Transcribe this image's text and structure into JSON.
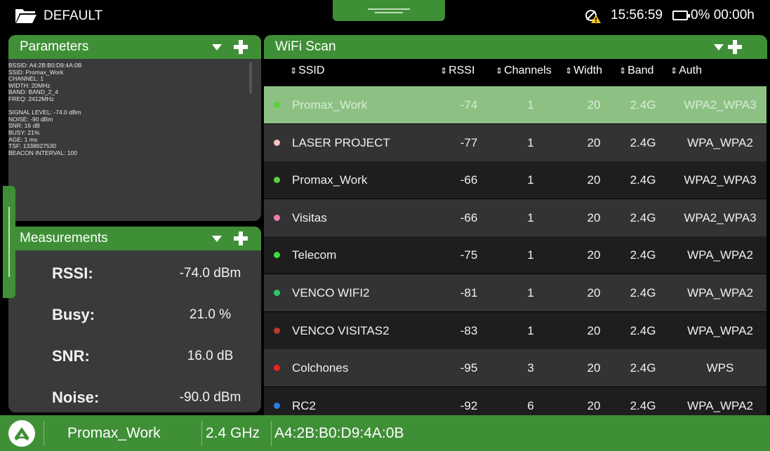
{
  "header": {
    "app_name": "DEFAULT",
    "time": "15:56:59",
    "battery": "0% 00:00h"
  },
  "parameters": {
    "title": "Parameters",
    "lines": [
      "BSSID: A4:2B:B0:D9:4A:0B",
      "SSID: Promax_Work",
      "CHANNEL: 1",
      "WIDTH: 20MHz",
      "BAND: BAND_2_4",
      "FREQ: 2412MHz",
      "",
      "SIGNAL LEVEL: -74.0 dBm",
      "NOISE: -90 dBm",
      "SNR: 16 dB",
      "BUSY: 21%",
      "AGE: 1 ms",
      "TSF: 1338927530",
      "BEACON INTERVAL: 100"
    ]
  },
  "measurements": {
    "title": "Measurements",
    "items": [
      {
        "label": "RSSI:",
        "value": "-74.0 dBm"
      },
      {
        "label": "Busy:",
        "value": "21.0 %"
      },
      {
        "label": "SNR:",
        "value": "16.0 dB"
      },
      {
        "label": "Noise:",
        "value": "-90.0 dBm"
      }
    ]
  },
  "wifi_scan": {
    "title": "WiFi Scan",
    "columns": [
      "SSID",
      "RSSI",
      "Channels",
      "Width",
      "Band",
      "Auth"
    ],
    "rows": [
      {
        "ssid": "Promax_Work",
        "rssi": "-74",
        "channels": "1",
        "width": "20",
        "band": "2.4G",
        "auth": "WPA2_WPA3",
        "dot": "#58d13c",
        "selected": true
      },
      {
        "ssid": "LASER PROJECT",
        "rssi": "-77",
        "channels": "1",
        "width": "20",
        "band": "2.4G",
        "auth": "WPA_WPA2",
        "dot": "#f4c3bf",
        "selected": false
      },
      {
        "ssid": "Promax_Work",
        "rssi": "-66",
        "channels": "1",
        "width": "20",
        "band": "2.4G",
        "auth": "WPA2_WPA3",
        "dot": "#58d13c",
        "selected": false
      },
      {
        "ssid": "Visitas",
        "rssi": "-66",
        "channels": "1",
        "width": "20",
        "band": "2.4G",
        "auth": "WPA2_WPA3",
        "dot": "#f07db0",
        "selected": false
      },
      {
        "ssid": "Telecom",
        "rssi": "-75",
        "channels": "1",
        "width": "20",
        "band": "2.4G",
        "auth": "WPA_WPA2",
        "dot": "#3ce03c",
        "selected": false
      },
      {
        "ssid": "VENCO WIFI2",
        "rssi": "-81",
        "channels": "1",
        "width": "20",
        "band": "2.4G",
        "auth": "WPA_WPA2",
        "dot": "#2ec86a",
        "selected": false
      },
      {
        "ssid": "VENCO VISITAS2",
        "rssi": "-83",
        "channels": "1",
        "width": "20",
        "band": "2.4G",
        "auth": "WPA_WPA2",
        "dot": "#c0392b",
        "selected": false
      },
      {
        "ssid": "Colchones",
        "rssi": "-95",
        "channels": "3",
        "width": "20",
        "band": "2.4G",
        "auth": "WPS",
        "dot": "#f02020",
        "selected": false
      },
      {
        "ssid": "RC2",
        "rssi": "-92",
        "channels": "6",
        "width": "20",
        "band": "2.4G",
        "auth": "WPA_WPA2",
        "dot": "#2a7de1",
        "selected": false
      }
    ]
  },
  "footer": {
    "ssid": "Promax_Work",
    "band": "2.4 GHz",
    "bssid": "A4:2B:B0:D9:4A:0B"
  },
  "colors": {
    "accent": "#3f8f37",
    "panel": "#3a3a3a",
    "row_dark": "#1e1e1e",
    "row_light": "#333333",
    "row_selected": "#8cc183"
  }
}
